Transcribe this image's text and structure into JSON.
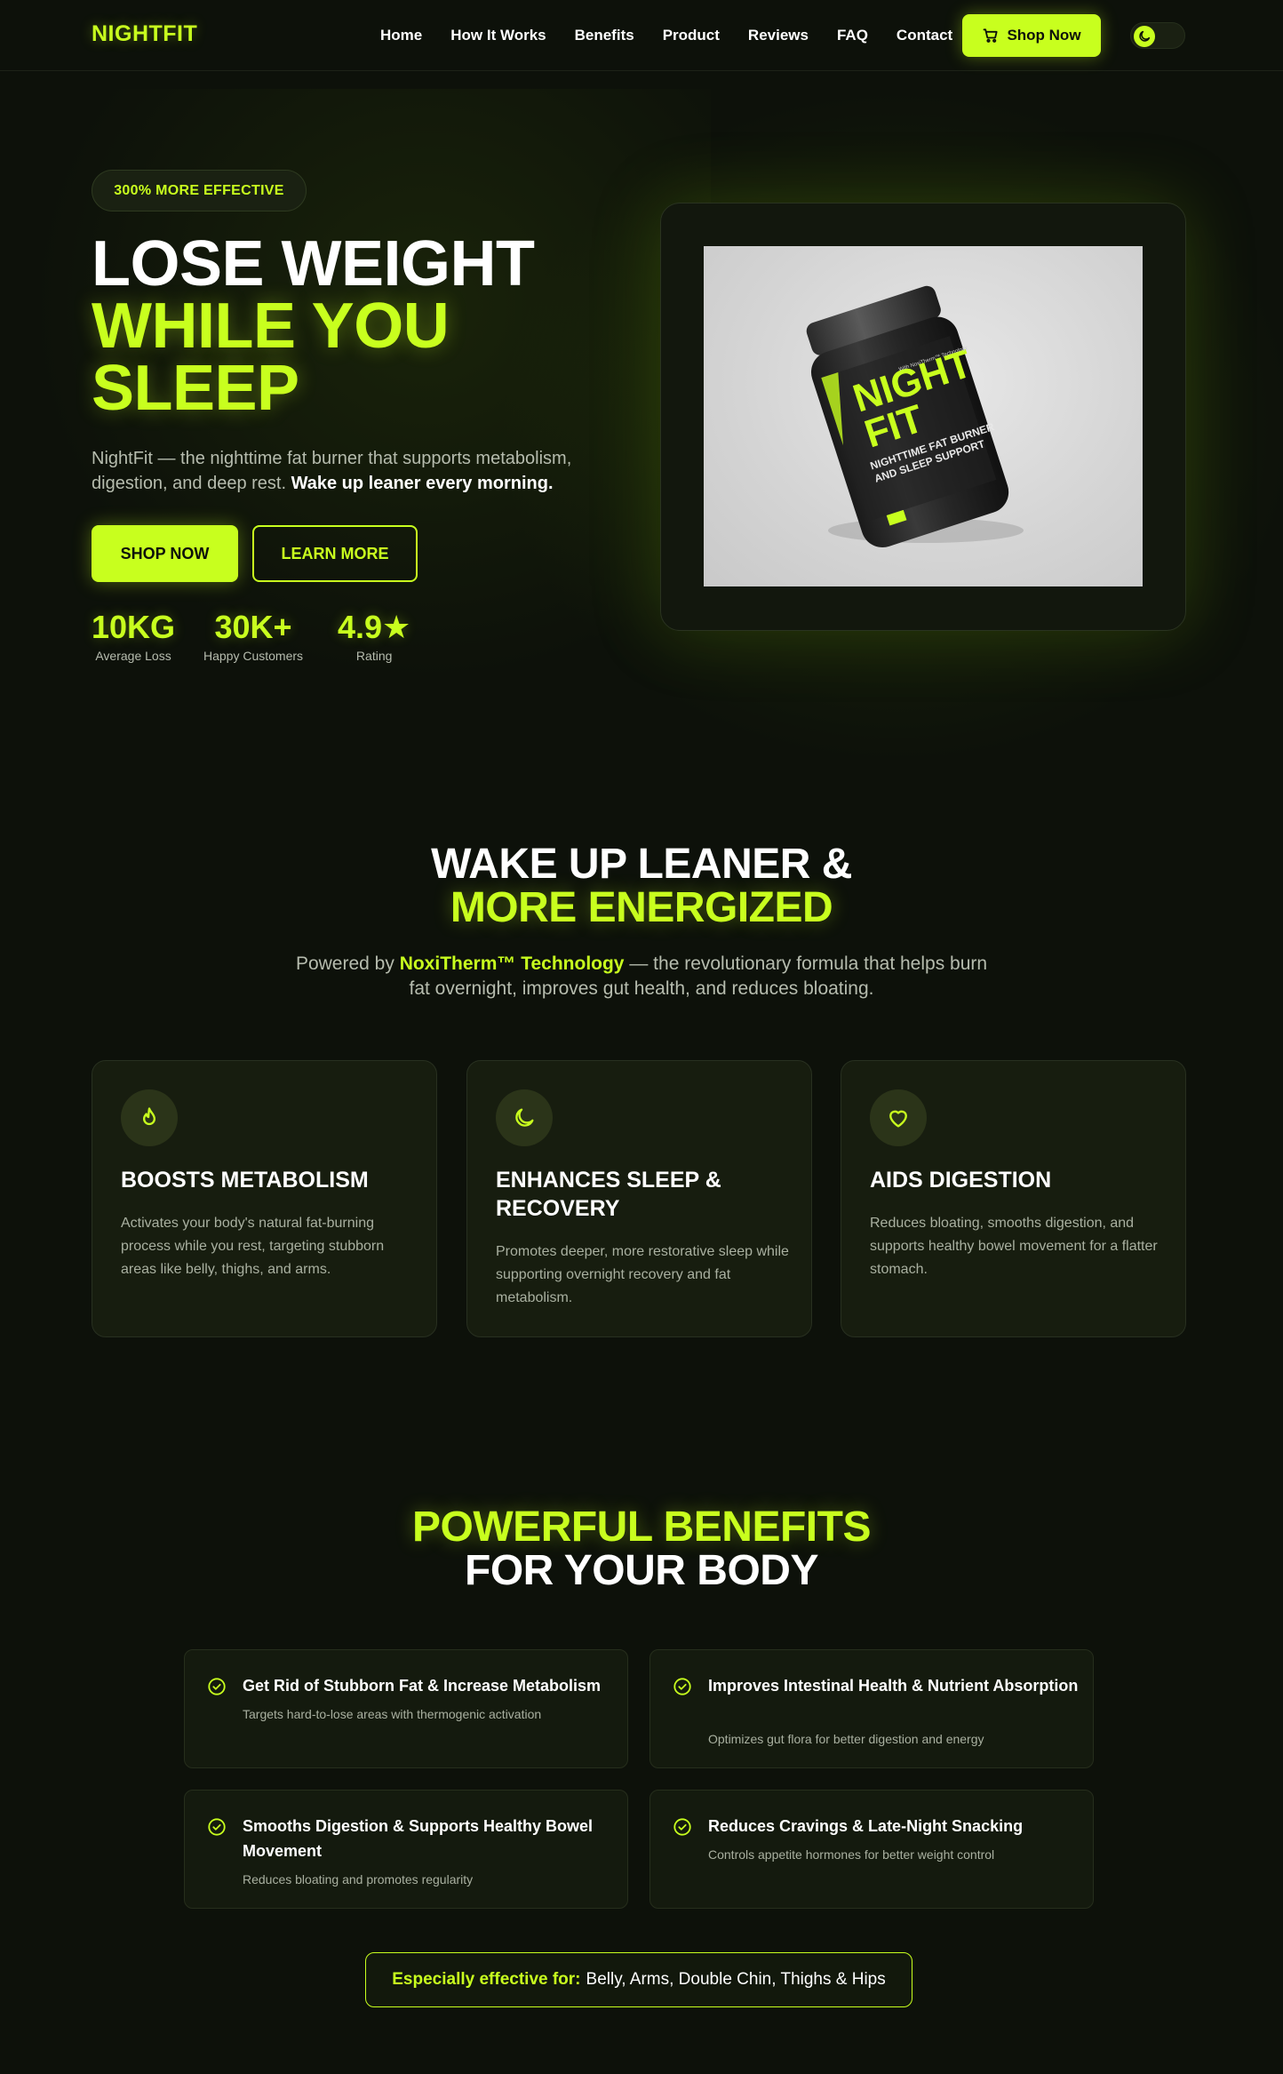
{
  "brand": {
    "logo": "NIGHTFIT",
    "accent_color": "#c8ff1e",
    "background_color": "#0d110a"
  },
  "nav": {
    "links": [
      "Home",
      "How It Works",
      "Benefits",
      "Product",
      "Reviews",
      "FAQ",
      "Contact"
    ],
    "cta_label": "Shop Now",
    "cta_icon": "cart-icon",
    "theme_toggle_icon": "moon-icon"
  },
  "hero": {
    "badge": "300% MORE EFFECTIVE",
    "title_line1": "LOSE WEIGHT",
    "title_line2": "WHILE YOU",
    "title_line3": "SLEEP",
    "subtitle": "NightFit — the nighttime fat burner that supports metabolism, digestion, and deep rest.",
    "subtitle_bold": "Wake up leaner every morning.",
    "primary_button": "SHOP NOW",
    "secondary_button": "LEARN MORE",
    "stats": [
      {
        "value": "10KG",
        "label": "Average Loss"
      },
      {
        "value": "30K+",
        "label": "Happy Customers"
      },
      {
        "value": "4.9★",
        "label": "Rating"
      }
    ],
    "product_label": {
      "brand_line1": "NIGHT",
      "brand_line2": "FIT",
      "tag": "With NoxiTherm™ Technology",
      "desc_line1": "NIGHTTIME FAT BURNER",
      "desc_line2": "AND SLEEP SUPPORT"
    }
  },
  "features_section": {
    "title_line1": "WAKE UP LEANER &",
    "title_line2": "MORE ENERGIZED",
    "subtitle_prefix": "Powered by",
    "subtitle_tech": "NoxiTherm™ Technology",
    "subtitle_suffix": "— the revolutionary formula that helps burn fat overnight, improves gut health, and reduces bloating.",
    "cards": [
      {
        "icon": "flame-icon",
        "title": "BOOSTS METABOLISM",
        "text": "Activates your body's natural fat-burning process while you rest, targeting stubborn areas like belly, thighs, and arms."
      },
      {
        "icon": "moon-icon",
        "title": "ENHANCES SLEEP & RECOVERY",
        "text": "Promotes deeper, more restorative sleep while supporting overnight recovery and fat metabolism."
      },
      {
        "icon": "heart-icon",
        "title": "AIDS DIGESTION",
        "text": "Reduces bloating, smooths digestion, and supports healthy bowel movement for a flatter stomach."
      }
    ]
  },
  "benefits_section": {
    "title_line1": "POWERFUL BENEFITS",
    "title_line2": "FOR YOUR BODY",
    "items": [
      {
        "title": "Get Rid of Stubborn Fat & Increase Metabolism",
        "text": "Targets hard-to-lose areas with thermogenic activation"
      },
      {
        "title": "Improves Intestinal Health & Nutrient Absorption",
        "text": "Optimizes gut flora for better digestion and energy"
      },
      {
        "title": "Smooths Digestion & Supports Healthy Bowel Movement",
        "text": "Reduces bloating and promotes regularity"
      },
      {
        "title": "Reduces Cravings & Late-Night Snacking",
        "text": "Controls appetite hormones for better weight control"
      }
    ],
    "effective_label": "Especially effective for:",
    "effective_value": "Belly, Arms, Double Chin, Thighs & Hips"
  }
}
